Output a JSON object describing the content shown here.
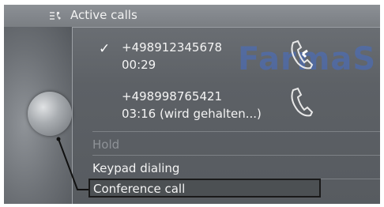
{
  "title": "Active calls",
  "calls": [
    {
      "number": "+498912345678",
      "status": "00:29",
      "active": true
    },
    {
      "number": "+498998765421",
      "status": "03:16 (wird gehalten...)",
      "active": false
    }
  ],
  "menu": {
    "hold": "Hold",
    "keypad": "Keypad dialing",
    "conference": "Conference call"
  },
  "watermark": "FarmaS"
}
